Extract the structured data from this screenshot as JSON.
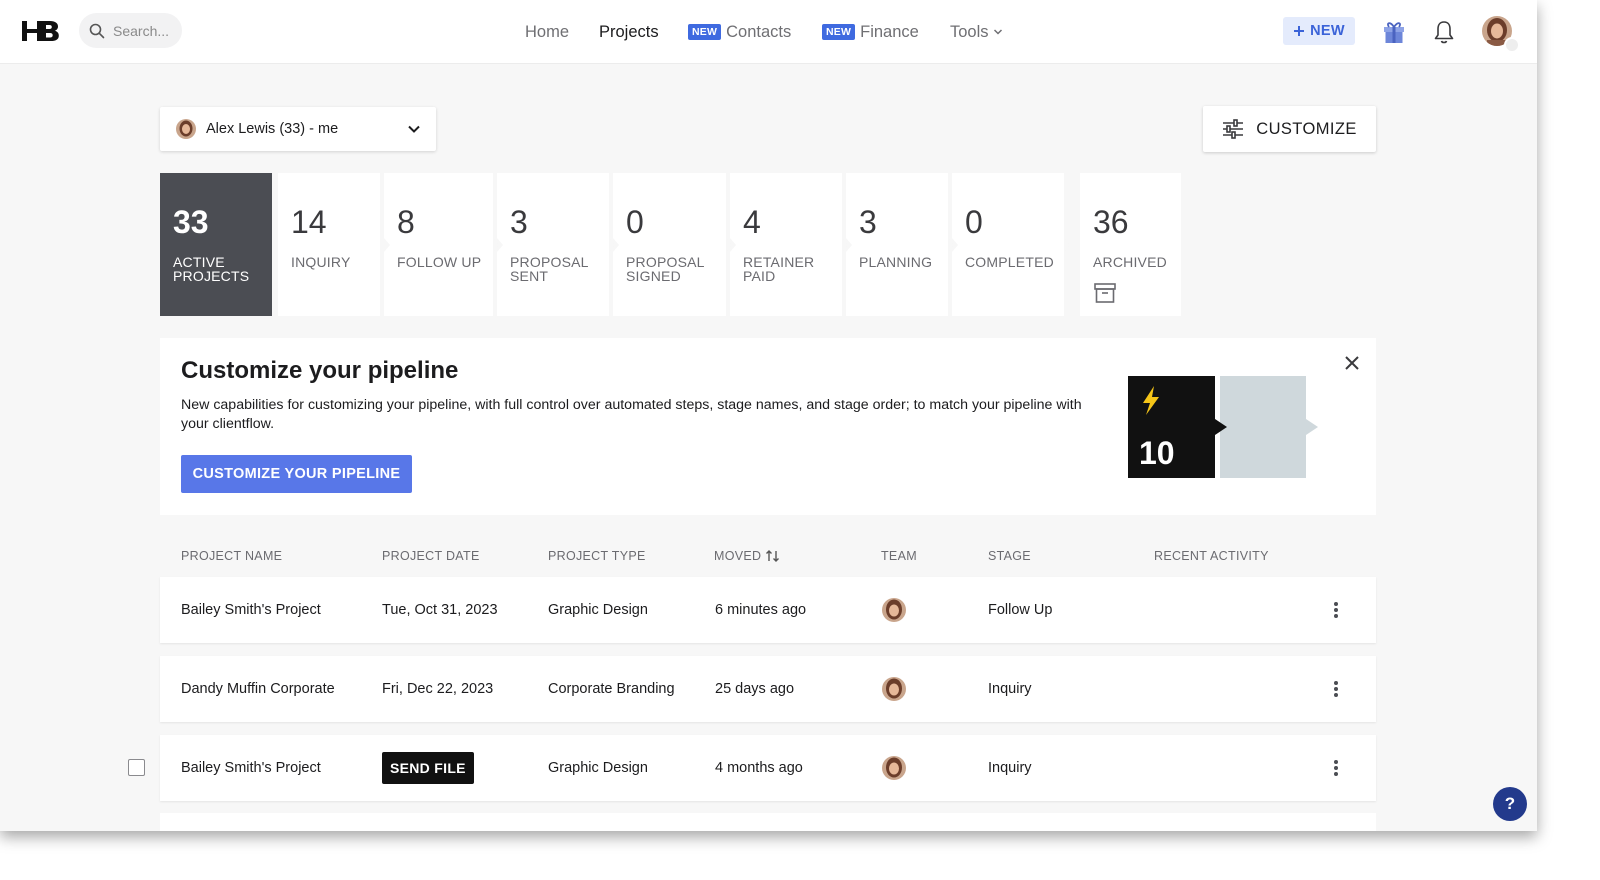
{
  "nav": {
    "search_placeholder": "Search...",
    "home": "Home",
    "projects": "Projects",
    "contacts": "Contacts",
    "finance": "Finance",
    "tools": "Tools",
    "new_badge": "NEW",
    "new_button": "NEW"
  },
  "toolbar": {
    "user_select": "Alex Lewis (33) - me",
    "customize": "CUSTOMIZE"
  },
  "stages": [
    {
      "count": "33",
      "label": "ACTIVE PROJECTS"
    },
    {
      "count": "14",
      "label": "INQUIRY"
    },
    {
      "count": "8",
      "label": "FOLLOW UP"
    },
    {
      "count": "3",
      "label": "PROPOSAL SENT"
    },
    {
      "count": "0",
      "label": "PROPOSAL SIGNED"
    },
    {
      "count": "4",
      "label": "RETAINER PAID"
    },
    {
      "count": "3",
      "label": "PLANNING"
    },
    {
      "count": "0",
      "label": "COMPLETED"
    },
    {
      "count": "36",
      "label": "ARCHIVED"
    }
  ],
  "promo": {
    "title": "Customize your pipeline",
    "body": "New capabilities for customizing your pipeline, with full control over automated steps, stage names, and stage order; to match your pipeline with your clientflow.",
    "cta": "CUSTOMIZE YOUR PIPELINE",
    "art_number": "10"
  },
  "table": {
    "headers": [
      "PROJECT NAME",
      "PROJECT DATE",
      "PROJECT TYPE",
      "MOVED",
      "TEAM",
      "STAGE",
      "RECENT ACTIVITY"
    ],
    "rows": [
      {
        "name": "Bailey Smith's Project",
        "date": "Tue, Oct 31, 2023",
        "type": "Graphic Design",
        "moved": "6 minutes ago",
        "stage": "Follow Up"
      },
      {
        "name": "Dandy Muffin Corporate",
        "date": "Fri, Dec 22, 2023",
        "type": "Corporate Branding",
        "moved": "25 days ago",
        "stage": "Inquiry"
      },
      {
        "name": "Bailey Smith's Project",
        "date": "SEND FILE",
        "type": "Graphic Design",
        "moved": "4 months ago",
        "stage": "Inquiry"
      }
    ]
  },
  "help": "?",
  "colors": {
    "accent": "#5877e8",
    "badge": "#3f6ae0",
    "active_tile": "#4b4d53",
    "help": "#233a8c"
  }
}
